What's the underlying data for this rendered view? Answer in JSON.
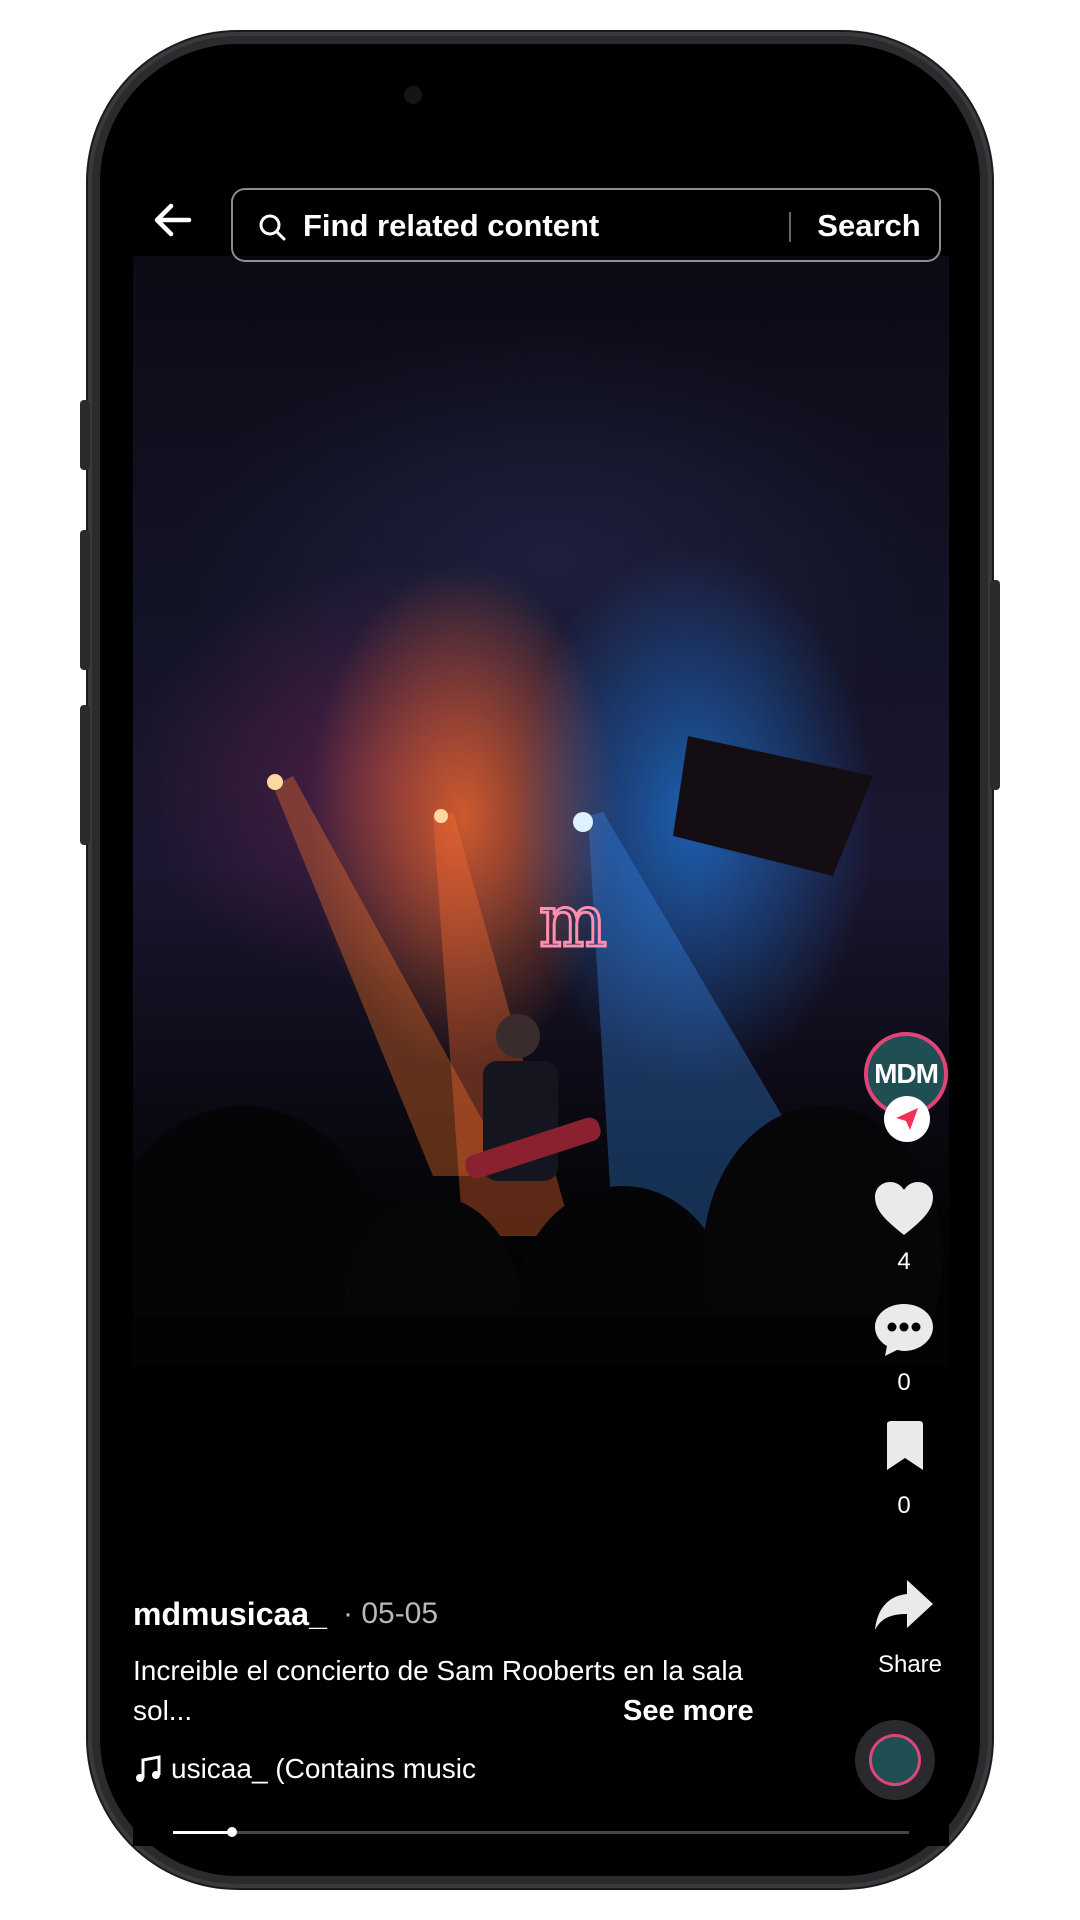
{
  "search": {
    "placeholder": "Find related content",
    "button_label": "Search"
  },
  "icons": {
    "back": "arrow-left-icon",
    "search": "magnifier-icon",
    "like": "heart-icon",
    "comment": "speech-bubble-icon",
    "save": "bookmark-icon",
    "share": "share-arrow-icon",
    "music": "music-note-icon"
  },
  "creator": {
    "avatar_text": "MDM",
    "avatar_ring_color": "#e0457a",
    "avatar_bg_color": "#1f4f52"
  },
  "actions": {
    "likes": "4",
    "comments": "0",
    "saves": "0",
    "share_label": "Share"
  },
  "post": {
    "username": "mdmusicaa_",
    "date": "· 05-05",
    "caption": "Increible el concierto de Sam Rooberts en la sala sol...",
    "see_more": "See more",
    "music": "usicaa_ (Contains music"
  },
  "playback": {
    "progress": 0.08
  }
}
